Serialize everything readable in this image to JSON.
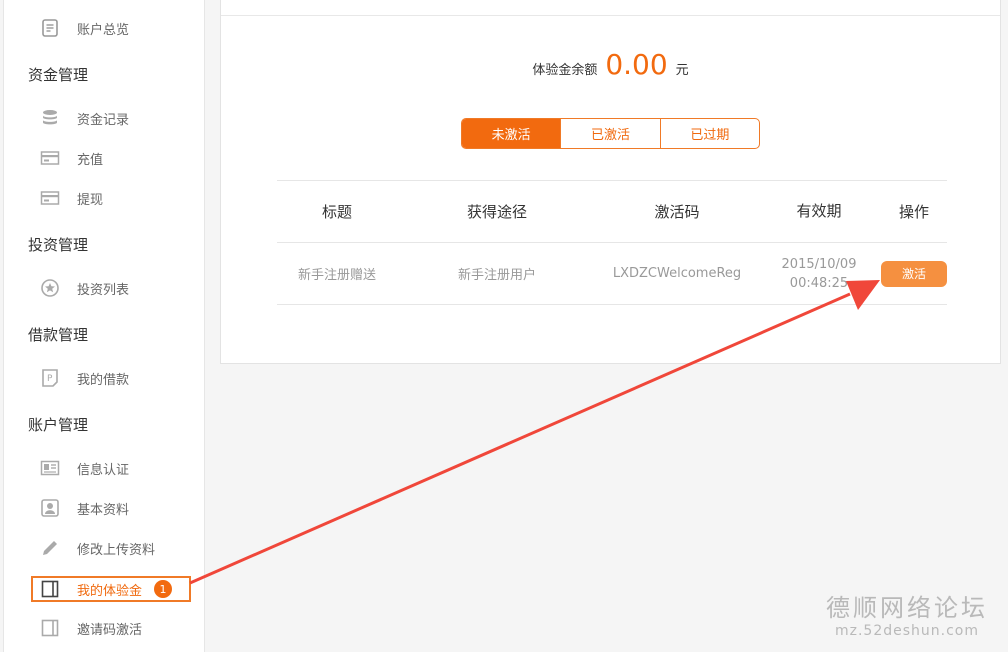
{
  "sidebar": {
    "top_item": {
      "label": "账户总览",
      "icon": "document-icon"
    },
    "groups": [
      {
        "title": "资金管理",
        "items": [
          {
            "label": "资金记录",
            "icon": "coins-icon"
          },
          {
            "label": "充值",
            "icon": "card-icon"
          },
          {
            "label": "提现",
            "icon": "card-icon"
          }
        ]
      },
      {
        "title": "投资管理",
        "items": [
          {
            "label": "投资列表",
            "icon": "star-circle-icon"
          }
        ]
      },
      {
        "title": "借款管理",
        "items": [
          {
            "label": "我的借款",
            "icon": "receipt-icon"
          }
        ]
      },
      {
        "title": "账户管理",
        "items": [
          {
            "label": "信息认证",
            "icon": "id-card-icon"
          },
          {
            "label": "基本资料",
            "icon": "user-icon"
          },
          {
            "label": "修改上传资料",
            "icon": "pencil-icon"
          },
          {
            "label": "我的体验金",
            "icon": "book-icon",
            "badge": "1",
            "active": true
          },
          {
            "label": "邀请码激活",
            "icon": "book-icon"
          }
        ]
      }
    ]
  },
  "main": {
    "balance_label": "体验金余额",
    "balance_amount": "0.00",
    "balance_unit": "元",
    "tabs": [
      {
        "label": "未激活",
        "active": true
      },
      {
        "label": "已激活",
        "active": false
      },
      {
        "label": "已过期",
        "active": false
      }
    ],
    "table": {
      "headers": [
        "标题",
        "获得途径",
        "激活码",
        "有效期",
        "操作"
      ],
      "rows": [
        {
          "title": "新手注册赠送",
          "source": "新手注册用户",
          "code": "LXDZCWelcomeReg",
          "date": "2015/10/09",
          "time": "00:48:25",
          "action": "激活"
        }
      ]
    }
  },
  "watermark": {
    "line1": "德顺网络论坛",
    "line2": "mz.52deshun.com"
  },
  "colors": {
    "accent": "#f26a0f",
    "button": "#f59040",
    "arrow": "#f0473a"
  }
}
